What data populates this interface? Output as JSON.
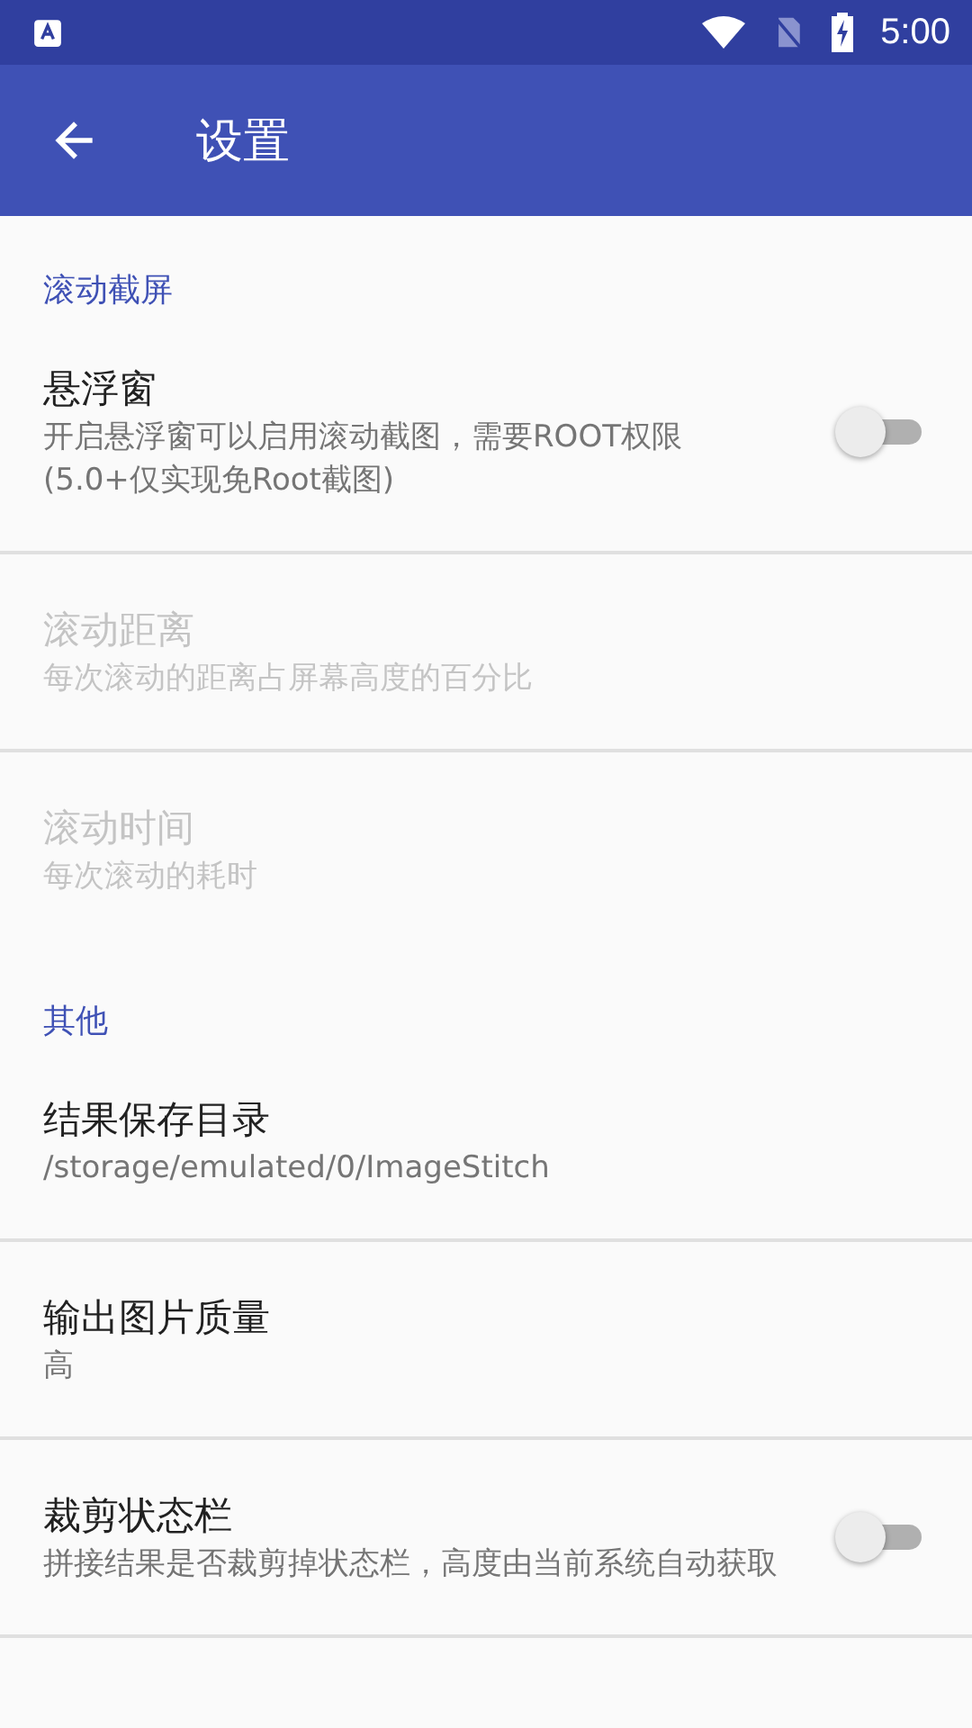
{
  "status_bar": {
    "time": "5:00"
  },
  "toolbar": {
    "title": "设置"
  },
  "sections": [
    {
      "header": "滚动截屏",
      "items": [
        {
          "title": "悬浮窗",
          "summary": "开启悬浮窗可以启用滚动截图，需要ROOT权限(5.0+仅实现免Root截图)",
          "disabled": false,
          "kind": "switch",
          "on": false
        },
        {
          "title": "滚动距离",
          "summary": "每次滚动的距离占屏幕高度的百分比",
          "disabled": true,
          "kind": "plain"
        },
        {
          "title": "滚动时间",
          "summary": "每次滚动的耗时",
          "disabled": true,
          "kind": "plain"
        }
      ]
    },
    {
      "header": "其他",
      "items": [
        {
          "title": "结果保存目录",
          "summary": "/storage/emulated/0/ImageStitch",
          "disabled": false,
          "kind": "plain"
        },
        {
          "title": "输出图片质量",
          "summary": "高",
          "disabled": false,
          "kind": "plain"
        },
        {
          "title": "裁剪状态栏",
          "summary": "拼接结果是否裁剪掉状态栏，高度由当前系统自动获取",
          "disabled": false,
          "kind": "switch",
          "on": false
        }
      ]
    }
  ]
}
